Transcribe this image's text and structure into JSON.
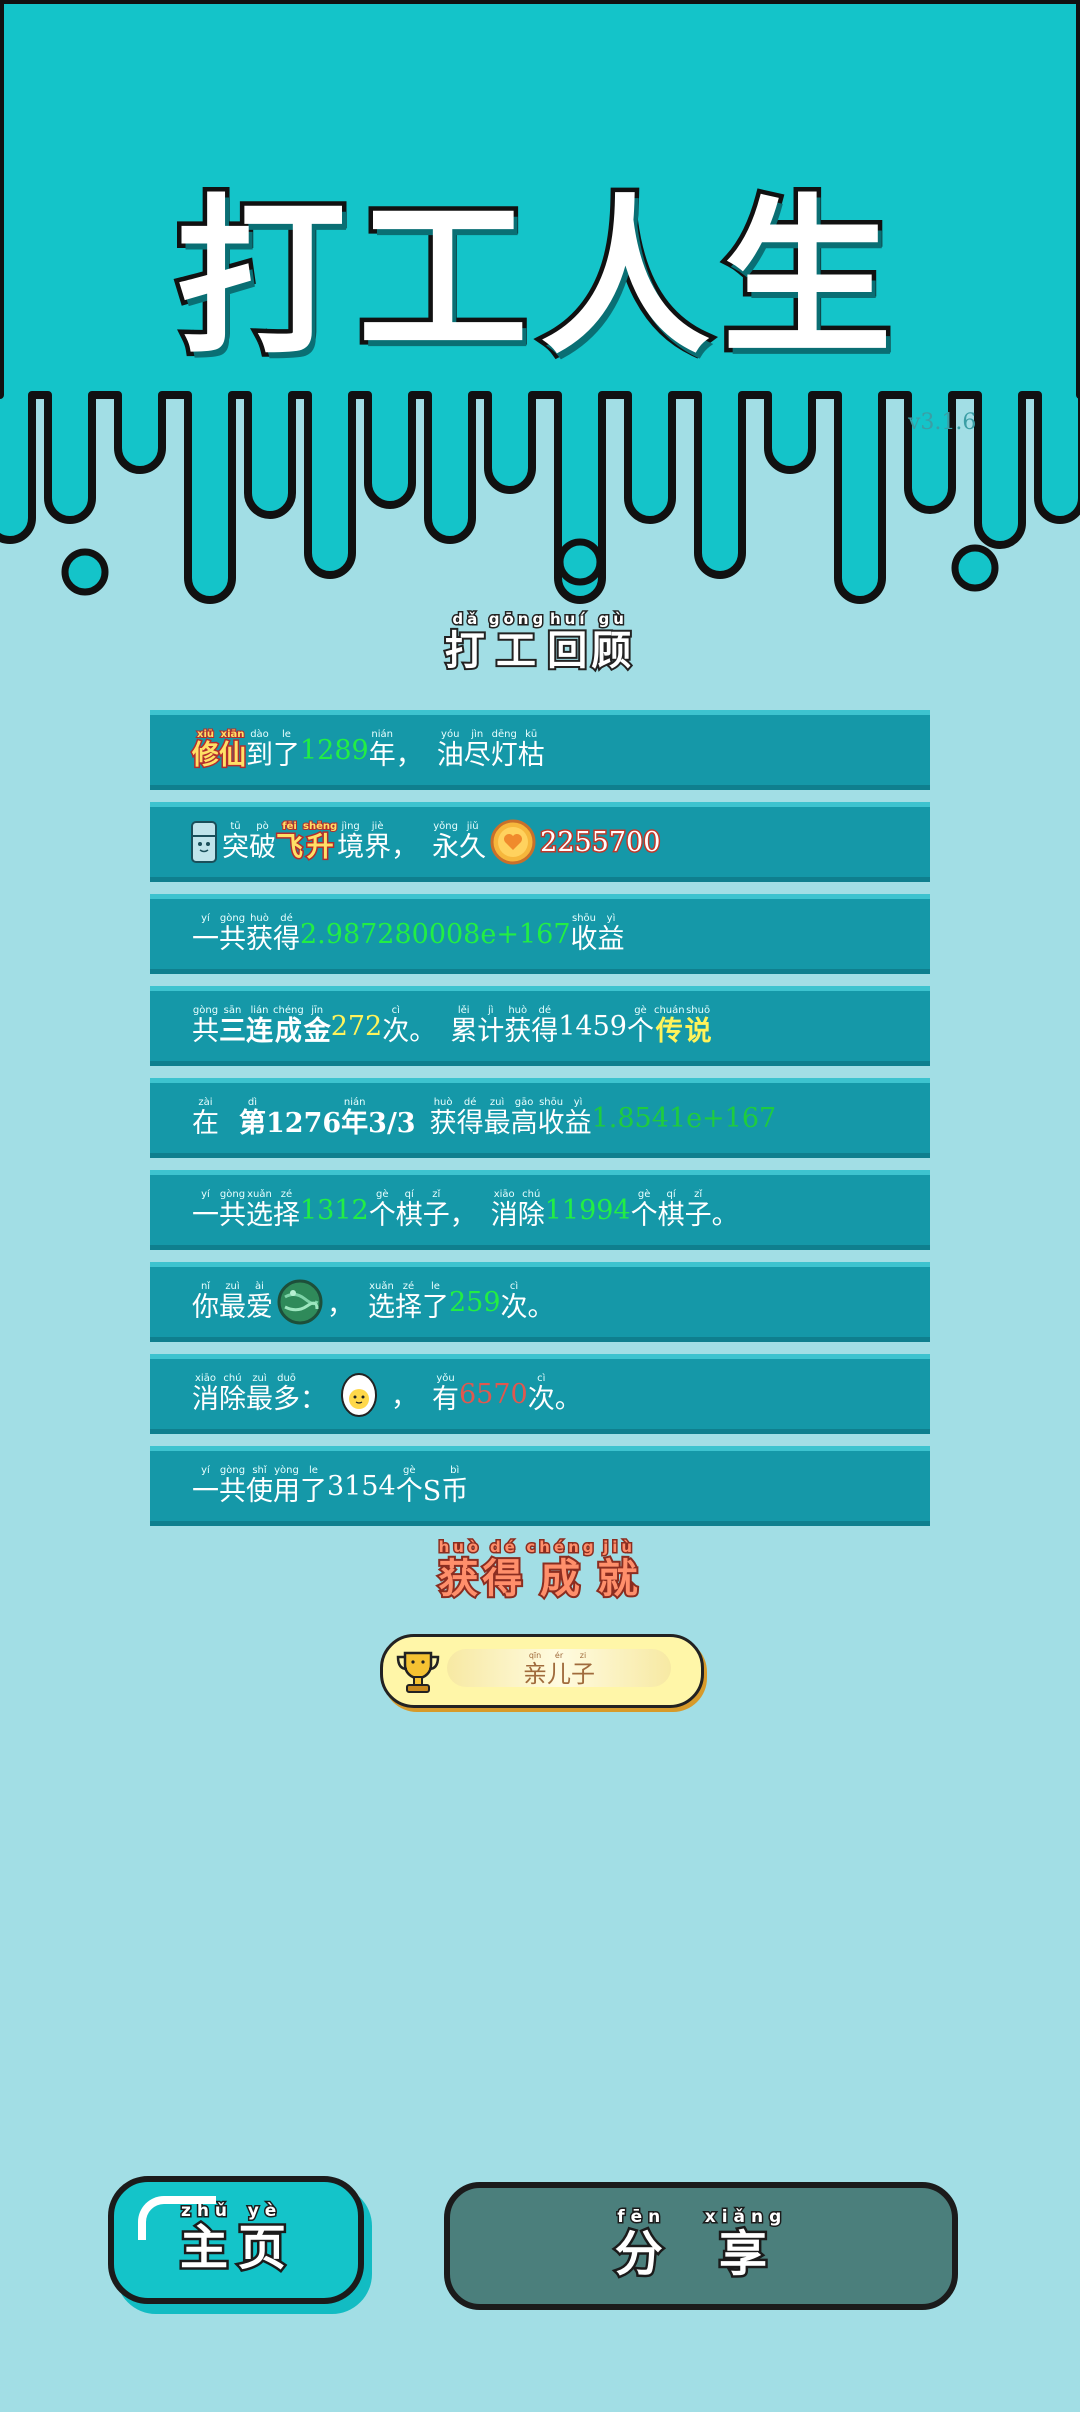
{
  "header": {
    "title": "打工人生",
    "version": "v3.1.6"
  },
  "review": {
    "title": [
      {
        "ch": "打",
        "py": "dǎ"
      },
      {
        "ch": "工",
        "py": "gōng"
      },
      {
        "ch": "回",
        "py": "huí"
      },
      {
        "ch": "顾",
        "py": "gù"
      }
    ]
  },
  "rows": {
    "r1": {
      "realm": "修仙",
      "realm_py": [
        "xiū",
        "xiān"
      ],
      "a": "到了",
      "a_py": [
        "dào",
        "le"
      ],
      "years": "1289",
      "b": "年，",
      "b_py": [
        "nián",
        ""
      ],
      "c": "油尽灯枯",
      "c_py": [
        "yóu",
        "jìn",
        "dēng",
        "kū"
      ]
    },
    "r2": {
      "a": "突破",
      "a_py": [
        "tū",
        "pò"
      ],
      "realm": "飞升",
      "realm_py": [
        "fēi",
        "shēng"
      ],
      "b": "境界，",
      "b_py": [
        "jìng",
        "jiè",
        ""
      ],
      "c": "永久",
      "c_py": [
        "yǒng",
        "jiǔ"
      ],
      "coins": "2255700"
    },
    "r3": {
      "a": "一共获得",
      "a_py": [
        "yí",
        "gòng",
        "huò",
        "dé"
      ],
      "income": "2.987280008e+167",
      "b": "收益",
      "b_py": [
        "shōu",
        "yì"
      ]
    },
    "r4": {
      "a": "共",
      "a_py": [
        "gòng"
      ],
      "combo": "三连成金",
      "combo_py": [
        "sān",
        "lián",
        "chéng",
        "jīn"
      ],
      "count": "272",
      "b": "次。",
      "b_py": [
        "cì",
        ""
      ],
      "c": "累计获得",
      "c_py": [
        "lěi",
        "jì",
        "huò",
        "dé"
      ],
      "total": "1459",
      "d": "个",
      "d_py": [
        "gè"
      ],
      "grade": "传说",
      "grade_py": [
        "chuán",
        "shuō"
      ]
    },
    "r5": {
      "a": "在",
      "a_py": [
        "zài"
      ],
      "date_pre": "第",
      "date_pre_py": "dì",
      "year": "1276",
      "year_suffix": "年",
      "year_suffix_py": "nián",
      "month_day": "3/3",
      "b": "获得最高收益",
      "b_py": [
        "huò",
        "dé",
        "zuì",
        "gāo",
        "shōu",
        "yì"
      ],
      "best": "1.8541e+167"
    },
    "r6": {
      "a": "一共选择",
      "a_py": [
        "yí",
        "gòng",
        "xuǎn",
        "zé"
      ],
      "chosen": "1312",
      "b": "个棋子，",
      "b_py": [
        "gè",
        "qí",
        "zǐ",
        ""
      ],
      "c": "消除",
      "c_py": [
        "xiāo",
        "chú"
      ],
      "cleared": "11994",
      "d": "个棋子。",
      "d_py": [
        "gè",
        "qí",
        "zǐ",
        ""
      ]
    },
    "r7": {
      "a": "你最爱",
      "a_py": [
        "nǐ",
        "zuì",
        "ài"
      ],
      "b": "，",
      "c": "选择了",
      "c_py": [
        "xuǎn",
        "zé",
        "le"
      ],
      "times": "259",
      "d": "次。",
      "d_py": [
        "cì",
        ""
      ],
      "fav_icon": "green-planet-icon"
    },
    "r8": {
      "a": "消除最多：",
      "a_py": [
        "xiāo",
        "chú",
        "zuì",
        "duō",
        ""
      ],
      "b": "，",
      "c": "有",
      "c_py": [
        "yǒu"
      ],
      "times": "6570",
      "d": "次。",
      "d_py": [
        "cì",
        ""
      ],
      "most_icon": "egg-icon"
    },
    "r9": {
      "a": "一共使用了",
      "a_py": [
        "yí",
        "gòng",
        "shǐ",
        "yòng",
        "le"
      ],
      "coins": "3154",
      "b": "个S币",
      "b_py": [
        "gè",
        "",
        "bì"
      ]
    }
  },
  "achievements": {
    "title": [
      {
        "ch": "获",
        "py": "huò"
      },
      {
        "ch": "得",
        "py": "dé"
      },
      {
        "ch": "成",
        "py": "chéng"
      },
      {
        "ch": "就",
        "py": "jiù"
      }
    ],
    "badge_label": "亲儿子",
    "badge_py": [
      "qīn",
      "ér",
      "zi"
    ],
    "badge_icon": "trophy-icon"
  },
  "buttons": {
    "home": {
      "chars": [
        "主",
        "页"
      ],
      "py": [
        "zhǔ",
        "yè"
      ]
    },
    "share": {
      "chars": [
        "分",
        "享"
      ],
      "py": [
        "fēn",
        "xiǎng"
      ]
    }
  },
  "colors": {
    "top_bg": "#14c4c9",
    "page_bg": "#a2dee5",
    "row_bg": "#1598a8",
    "highlight_green": "#22ee44",
    "highlight_yellow": "#fff35a",
    "highlight_red": "#e0584f",
    "share_button": "#4b7f7c"
  }
}
